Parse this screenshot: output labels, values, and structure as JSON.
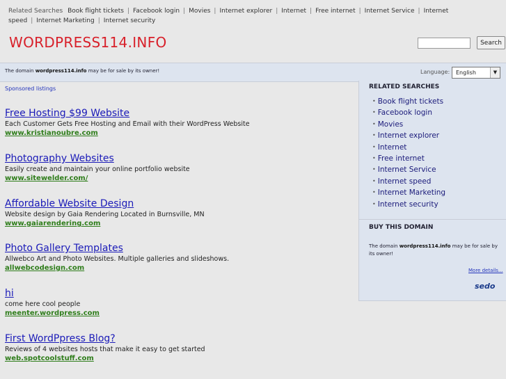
{
  "topbar": {
    "label": "Related Searches",
    "links": [
      "Book flight tickets",
      "Facebook login",
      "Movies",
      "Internet explorer",
      "Internet",
      "Free internet",
      "Internet Service",
      "Internet speed",
      "Internet Marketing",
      "Internet security"
    ]
  },
  "logo": "WORDPRESS114.INFO",
  "search": {
    "button": "Search",
    "value": "",
    "placeholder": ""
  },
  "notice": {
    "pre": "The domain ",
    "domain": "wordpress114.info",
    "post": " may be for sale by its owner!"
  },
  "language": {
    "label": "Language:",
    "selected": "English"
  },
  "sponsored_label": "Sponsored listings",
  "listings": [
    {
      "title": "Free Hosting $99 Website",
      "desc": "Each Customer Gets Free Hosting and Email with their WordPress Website",
      "url": "www.kristianoubre.com"
    },
    {
      "title": "Photography Websites",
      "desc": "Easily create and maintain your online portfolio website",
      "url": "www.sitewelder.com/"
    },
    {
      "title": "Affordable Website Design",
      "desc": "Website design by Gaia Rendering Located in Burnsville, MN",
      "url": "www.gaiarendering.com"
    },
    {
      "title": "Photo Gallery Templates",
      "desc": "Allwebco Art and Photo Websites. Multiple galleries and slideshows.",
      "url": "allwebcodesign.com"
    },
    {
      "title": "hi",
      "desc": "come here cool people",
      "url": "meenter.wordpress.com"
    },
    {
      "title": "First WordPpress Blog?",
      "desc": "Reviews of 4 websites hosts that make it easy to get started",
      "url": "web.spotcoolstuff.com"
    }
  ],
  "sidebar": {
    "related_heading": "RELATED SEARCHES",
    "related": [
      "Book flight tickets",
      "Facebook login",
      "Movies",
      "Internet explorer",
      "Internet",
      "Free internet",
      "Internet Service",
      "Internet speed",
      "Internet Marketing",
      "Internet security"
    ],
    "buy_heading": "BUY THIS DOMAIN",
    "buy_pre": "The domain ",
    "buy_domain": "wordpress114.info",
    "buy_post": " may be for sale by its owner!",
    "more": "More details...",
    "sedo": "sedo"
  },
  "colors": {
    "logo": "#d8202a",
    "link": "#1a1ab8",
    "url": "#2e7d1a",
    "panel": "#dde4ef"
  }
}
